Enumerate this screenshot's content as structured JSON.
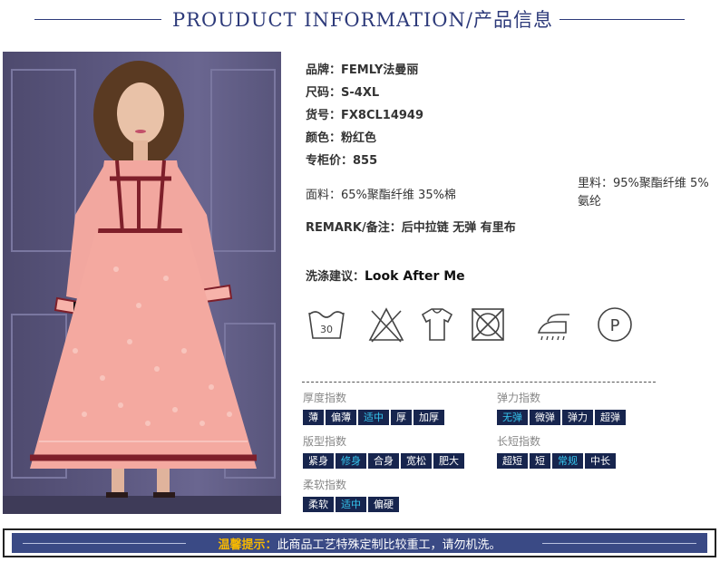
{
  "header": {
    "title": "PROUDUCT INFORMATION/产品信息"
  },
  "info": [
    {
      "key": "品牌：",
      "value": "FEMLY法曼丽"
    },
    {
      "key": "尺码：",
      "value": "S-4XL"
    },
    {
      "key": "货号：",
      "value": "FX8CL14949"
    },
    {
      "key": "颜色：",
      "value": "粉红色"
    },
    {
      "key": "专柜价：",
      "value": "855"
    }
  ],
  "fabric": {
    "key": "面料：",
    "value": "65%聚酯纤维 35%棉"
  },
  "lining": {
    "key": "里料：",
    "value": "95%聚酯纤维 5%氨纶"
  },
  "remark": {
    "key": "REMARK/备注：",
    "value": "后中拉链 无弹 有里布"
  },
  "wash": {
    "key": "洗涤建议：",
    "value": "Look After Me"
  },
  "care_icons": [
    {
      "name": "wash-30-icon",
      "text": "30"
    },
    {
      "name": "no-bleach-icon"
    },
    {
      "name": "hang-dry-icon"
    },
    {
      "name": "no-tumble-dry-icon"
    },
    {
      "name": "iron-icon"
    },
    {
      "name": "dry-clean-p-icon",
      "text": "P"
    }
  ],
  "indices": {
    "thickness": {
      "label": "厚度指数",
      "options": [
        "薄",
        "偏薄",
        "适中",
        "厚",
        "加厚"
      ],
      "selected": "适中"
    },
    "elasticity": {
      "label": "弹力指数",
      "options": [
        "无弹",
        "微弹",
        "弹力",
        "超弹"
      ],
      "selected": "无弹"
    },
    "fit": {
      "label": "版型指数",
      "options": [
        "紧身",
        "修身",
        "合身",
        "宽松",
        "肥大"
      ],
      "selected": "修身"
    },
    "length": {
      "label": "长短指数",
      "options": [
        "超短",
        "短",
        "常规",
        "中长"
      ],
      "selected": "常规"
    },
    "softness": {
      "label": "柔软指数",
      "options": [
        "柔软",
        "适中",
        "偏硬"
      ],
      "selected": "适中"
    }
  },
  "notice": {
    "highlight": "温馨提示：",
    "text": "此商品工艺特殊定制比较重工，请勿机洗。"
  },
  "colors": {
    "navy": "#17254e",
    "accent": "#35c6ef",
    "title": "#2d3a7a",
    "notice_bg": "#3a4a85",
    "notice_hl": "#f6b800"
  }
}
